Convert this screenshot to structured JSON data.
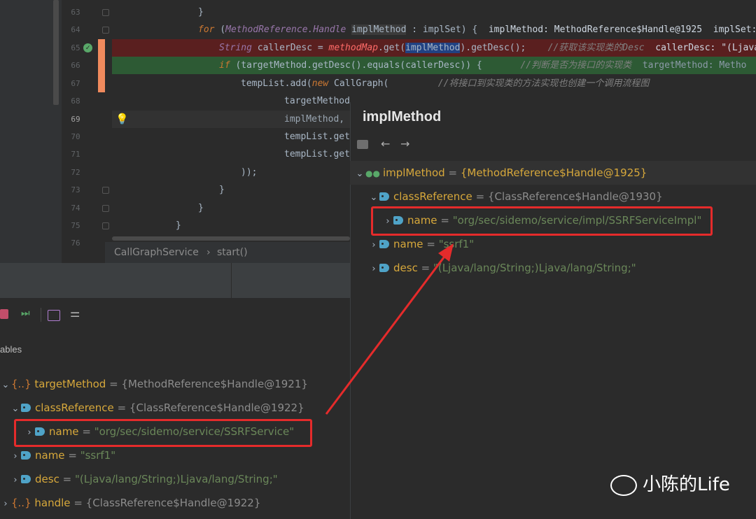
{
  "editor": {
    "lines": [
      {
        "num": "63"
      },
      {
        "num": "64"
      },
      {
        "num": "65"
      },
      {
        "num": "66"
      },
      {
        "num": "67"
      },
      {
        "num": "68"
      },
      {
        "num": "69"
      },
      {
        "num": "70"
      },
      {
        "num": "71"
      },
      {
        "num": "72"
      },
      {
        "num": "73"
      },
      {
        "num": "74"
      },
      {
        "num": "75"
      },
      {
        "num": "76"
      }
    ],
    "code": {
      "l63": "}",
      "l64_for": "for",
      "l64_open": " (",
      "l64_type": "MethodReference.Handle",
      "l64_var": "implMethod",
      "l64_rest": " : implSet) {  ",
      "l64_dbg": "implMethod: MethodReference$Handle@1925  implSet: ",
      "l65_type": "String",
      "l65_a": " callerDesc = ",
      "l65_map": "methodMap",
      "l65_b": ".get(",
      "l65_sel": "implMethod",
      "l65_c": ").getDesc();    ",
      "l65_cmt": "//获取该实现类的Desc",
      "l65_dbg": "  callerDesc: \"(Ljava",
      "l66_if": "if",
      "l66_a": " (targetMethod.getDesc().equals(callerDesc)) {       ",
      "l66_cmt": "//判断是否为接口的实现类",
      "l66_dbg": "  targetMethod: Metho",
      "l67_a": "tempList.add(",
      "l67_new": "new",
      "l67_b": " CallGraph(         ",
      "l67_cmt": "//将接口到实现类的方法实现也创建一个调用流程图",
      "l68": "targetMethod",
      "l69": "implMethod,",
      "l70": "tempList.get",
      "l71": "tempList.get",
      "l72": "));",
      "l73": "}",
      "l74": "}",
      "l75": "}"
    },
    "breadcrumb": {
      "class": "CallGraphService",
      "sep": "›",
      "method": "start()"
    }
  },
  "debug_panel": {
    "tab_label": "ables",
    "tree": [
      {
        "prefix": "{..}",
        "name": "targetMethod",
        "value": "{MethodReference$Handle@1921}"
      },
      {
        "name": "classReference",
        "value": "{ClassReference$Handle@1922}"
      },
      {
        "name": "name",
        "value": "\"org/sec/sidemo/service/SSRFService\""
      },
      {
        "name": "name",
        "value": "\"ssrf1\""
      },
      {
        "name": "desc",
        "value": "\"(Ljava/lang/String;)Ljava/lang/String;\""
      },
      {
        "prefix": "{..}",
        "name": "handle",
        "value": "{ClassReference$Handle@1922}"
      }
    ]
  },
  "popup": {
    "title": "implMethod",
    "tree": [
      {
        "name": "implMethod",
        "value": "{MethodReference$Handle@1925}"
      },
      {
        "name": "classReference",
        "value": "{ClassReference$Handle@1930}"
      },
      {
        "name": "name",
        "value": "\"org/sec/sidemo/service/impl/SSRFServiceImpl\""
      },
      {
        "name": "name",
        "value": "\"ssrf1\""
      },
      {
        "name": "desc",
        "value": "\"(Ljava/lang/String;)Ljava/lang/String;\""
      }
    ]
  },
  "watermark": "小陈的Life",
  "colors": {
    "annotation_red": "#e52b2b",
    "breakpoint_row": "#5a1f1f",
    "current_row": "#2d5a34"
  },
  "icons": [
    "check-icon",
    "lightbulb-icon",
    "tag-icon",
    "glasses-icon",
    "back-arrow-icon",
    "forward-arrow-icon",
    "wechat-icon"
  ]
}
